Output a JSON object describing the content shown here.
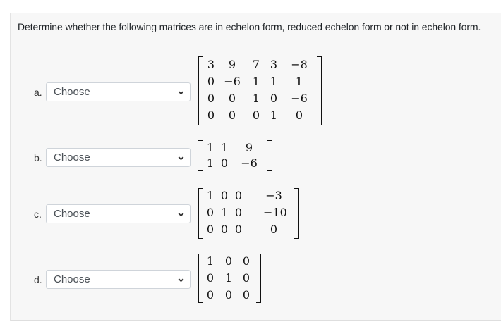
{
  "question": {
    "prompt": "Determine whether the following matrices are in echelon form, reduced echelon form or not in echelon form."
  },
  "items": [
    {
      "label": "a.",
      "select_value": "Choose",
      "matrix": [
        [
          "3",
          "9",
          "7",
          "3",
          "−8"
        ],
        [
          "0",
          "−6",
          "1",
          "1",
          "1"
        ],
        [
          "0",
          "0",
          "1",
          "0",
          "−6"
        ],
        [
          "0",
          "0",
          "0",
          "1",
          "0"
        ]
      ]
    },
    {
      "label": "b.",
      "select_value": "Choose",
      "matrix": [
        [
          "1",
          "1",
          "9"
        ],
        [
          "1",
          "0",
          "−6"
        ]
      ]
    },
    {
      "label": "c.",
      "select_value": "Choose",
      "matrix": [
        [
          "1",
          "0",
          "0",
          "−3"
        ],
        [
          "0",
          "1",
          "0",
          "−10"
        ],
        [
          "0",
          "0",
          "0",
          "0"
        ]
      ]
    },
    {
      "label": "d.",
      "select_value": "Choose",
      "matrix": [
        [
          "1",
          "0",
          "0"
        ],
        [
          "0",
          "1",
          "0"
        ],
        [
          "0",
          "0",
          "0"
        ]
      ]
    }
  ]
}
